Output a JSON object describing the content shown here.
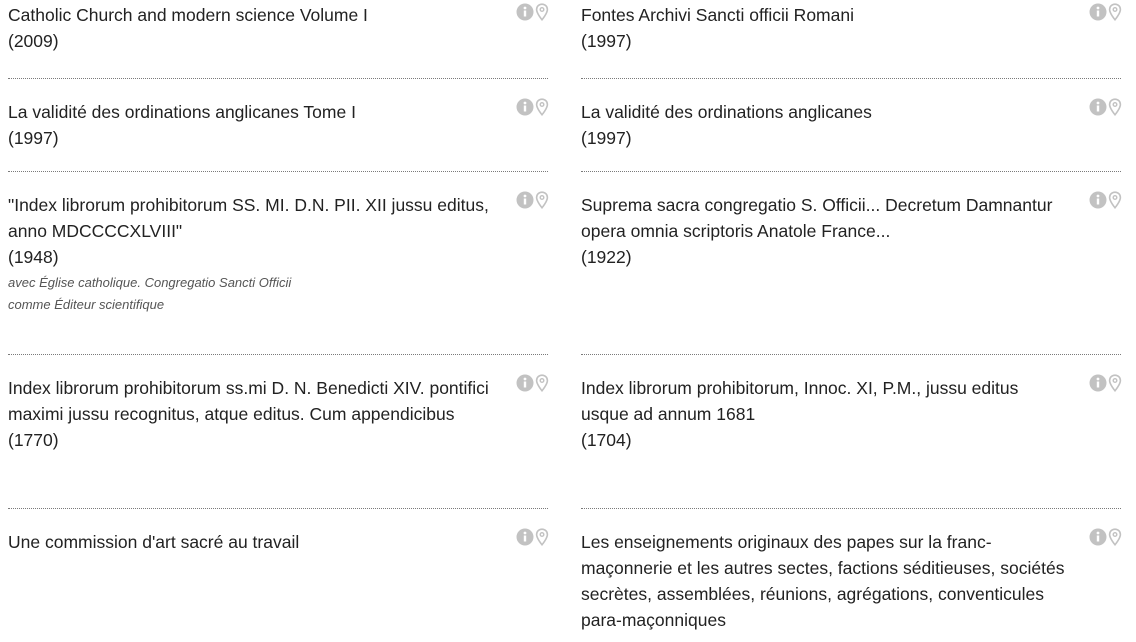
{
  "results": {
    "left": [
      {
        "title": "Catholic Church and modern science Volume I",
        "year": "(2009)",
        "contributor": ""
      },
      {
        "title": "La validité des ordinations anglicanes Tome I",
        "year": "(1997)",
        "contributor": ""
      },
      {
        "title": "\"Index librorum prohibitorum SS. MI. D.N. PII. XII jussu editus, anno MDCCCCXLVIII\"",
        "year": "(1948)",
        "contributor": "avec Église catholique. Congregatio Sancti Officii comme Éditeur scientifique"
      },
      {
        "title": "Index librorum prohibitorum ss.mi D. N. Benedicti XIV. pontifici maximi jussu recognitus, atque editus. Cum appendicibus",
        "year": "(1770)",
        "contributor": ""
      },
      {
        "title": "Une commission d'art sacré au travail",
        "year": "",
        "contributor": ""
      }
    ],
    "right": [
      {
        "title": "Fontes Archivi Sancti officii Romani",
        "year": "(1997)",
        "contributor": ""
      },
      {
        "title": "La validité des ordinations anglicanes",
        "year": "(1997)",
        "contributor": ""
      },
      {
        "title": "Suprema sacra congregatio S. Officii... Decretum Damnantur opera omnia scriptoris Anatole France...",
        "year": "(1922)",
        "contributor": ""
      },
      {
        "title": "Index librorum prohibitorum, Innoc. XI, P.M., jussu editus usque ad annum 1681",
        "year": "(1704)",
        "contributor": ""
      },
      {
        "title": "Les enseignements originaux des papes sur la franc-maçonnerie et les autres sectes, factions séditieuses, sociétés secrètes, assemblées, réunions, agrégations, conventicules para-maçonniques",
        "year": "",
        "contributor": ""
      }
    ]
  },
  "icons": {
    "info": "info-circle-icon",
    "location": "map-marker-icon",
    "color": "#c2c2c2"
  }
}
